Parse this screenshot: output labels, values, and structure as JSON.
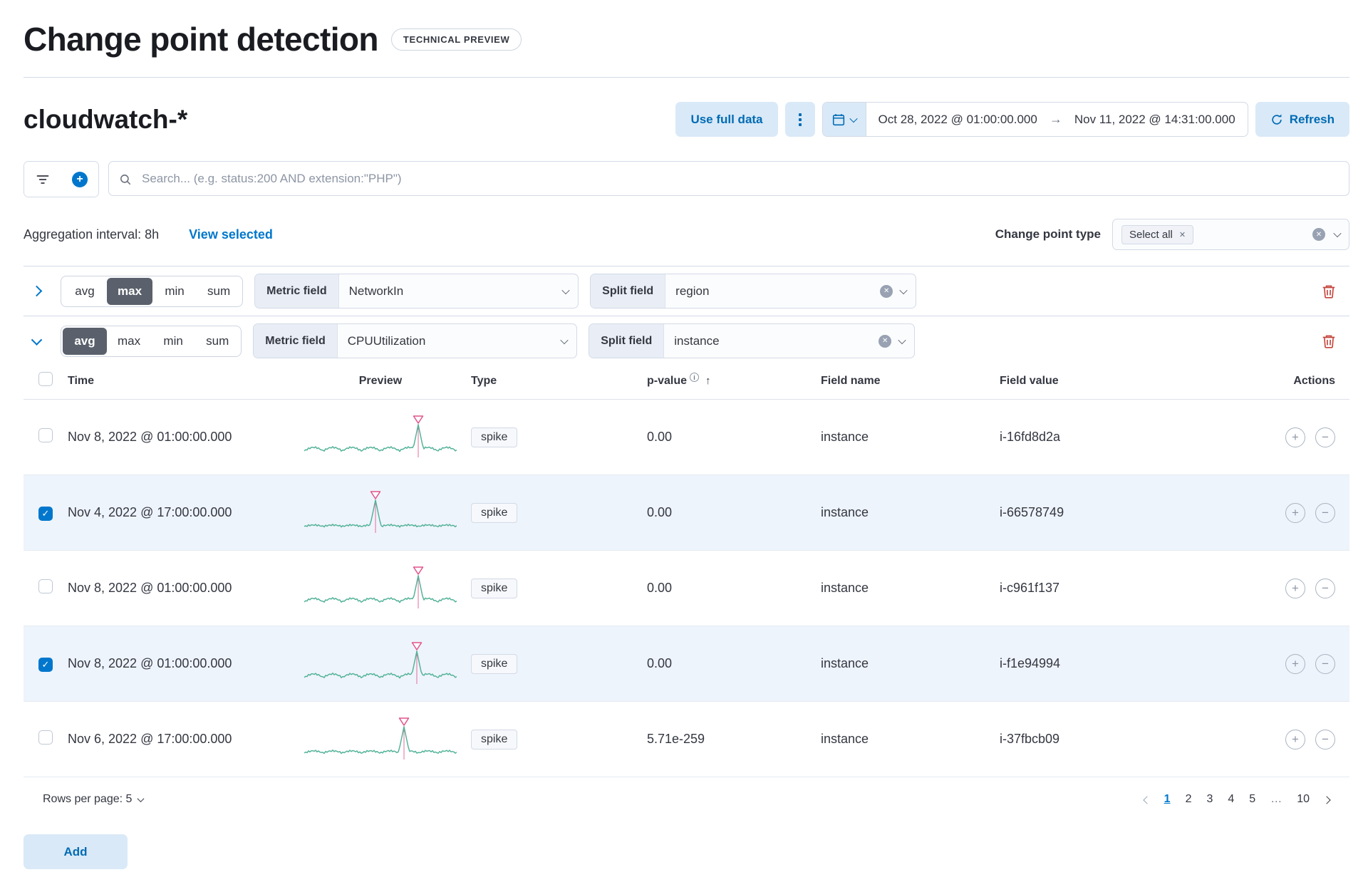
{
  "colors": {
    "primary": "#0077cc",
    "spark_line": "#54b399",
    "spark_marker": "#e0548c",
    "selected_row_bg": "#eef4fb",
    "danger": "#c4453c"
  },
  "page": {
    "title": "Change point detection",
    "tech_preview_badge": "TECHNICAL PREVIEW"
  },
  "toolbar": {
    "index_pattern": "cloudwatch-*",
    "use_full_data_label": "Use full data",
    "date_range": {
      "start": "Oct 28, 2022 @ 01:00:00.000",
      "end": "Nov 11, 2022 @ 14:31:00.000"
    },
    "refresh_label": "Refresh"
  },
  "search": {
    "placeholder": "Search... (e.g. status:200 AND extension:\"PHP\")"
  },
  "meta": {
    "aggregation_interval_label": "Aggregation interval: 8h",
    "view_selected_label": "View selected",
    "change_point_type_label": "Change point type",
    "change_point_type_selected": "Select all"
  },
  "configs": [
    {
      "expanded": false,
      "agg_buttons": [
        {
          "label": "avg",
          "selected": false
        },
        {
          "label": "max",
          "selected": true
        },
        {
          "label": "min",
          "selected": false
        },
        {
          "label": "sum",
          "selected": false
        }
      ],
      "metric_field_label": "Metric field",
      "metric_field_value": "NetworkIn",
      "split_field_label": "Split field",
      "split_field_value": "region"
    },
    {
      "expanded": true,
      "agg_buttons": [
        {
          "label": "avg",
          "selected": true
        },
        {
          "label": "max",
          "selected": false
        },
        {
          "label": "min",
          "selected": false
        },
        {
          "label": "sum",
          "selected": false
        }
      ],
      "metric_field_label": "Metric field",
      "metric_field_value": "CPUUtilization",
      "split_field_label": "Split field",
      "split_field_value": "instance"
    }
  ],
  "table": {
    "headers": {
      "time": "Time",
      "preview": "Preview",
      "type": "Type",
      "p_value": "p-value",
      "field_name": "Field name",
      "field_value": "Field value",
      "actions": "Actions"
    },
    "rows": [
      {
        "selected": false,
        "time": "Nov 8, 2022 @ 01:00:00.000",
        "type": "spike",
        "p_value": "0.00",
        "field_name": "instance",
        "field_value": "i-16fd8d2a",
        "preview": {
          "spike_pos": 0.75,
          "wave_amp": 5
        }
      },
      {
        "selected": true,
        "time": "Nov 4, 2022 @ 17:00:00.000",
        "type": "spike",
        "p_value": "0.00",
        "field_name": "instance",
        "field_value": "i-66578749",
        "preview": {
          "spike_pos": 0.47,
          "wave_amp": 2
        }
      },
      {
        "selected": false,
        "time": "Nov 8, 2022 @ 01:00:00.000",
        "type": "spike",
        "p_value": "0.00",
        "field_name": "instance",
        "field_value": "i-c961f137",
        "preview": {
          "spike_pos": 0.75,
          "wave_amp": 5
        }
      },
      {
        "selected": true,
        "time": "Nov 8, 2022 @ 01:00:00.000",
        "type": "spike",
        "p_value": "0.00",
        "field_name": "instance",
        "field_value": "i-f1e94994",
        "preview": {
          "spike_pos": 0.74,
          "wave_amp": 5
        }
      },
      {
        "selected": false,
        "time": "Nov 6, 2022 @ 17:00:00.000",
        "type": "spike",
        "p_value": "5.71e-259",
        "field_name": "instance",
        "field_value": "i-37fbcb09",
        "preview": {
          "spike_pos": 0.65,
          "wave_amp": 3
        }
      }
    ],
    "rows_per_page_label": "Rows per page: 5",
    "pagination": [
      {
        "label": "1",
        "active": true,
        "ellipsis": false
      },
      {
        "label": "2",
        "active": false,
        "ellipsis": false
      },
      {
        "label": "3",
        "active": false,
        "ellipsis": false
      },
      {
        "label": "4",
        "active": false,
        "ellipsis": false
      },
      {
        "label": "5",
        "active": false,
        "ellipsis": false
      },
      {
        "label": "…",
        "active": false,
        "ellipsis": true
      },
      {
        "label": "10",
        "active": false,
        "ellipsis": false
      }
    ]
  },
  "footer": {
    "add_label": "Add"
  }
}
